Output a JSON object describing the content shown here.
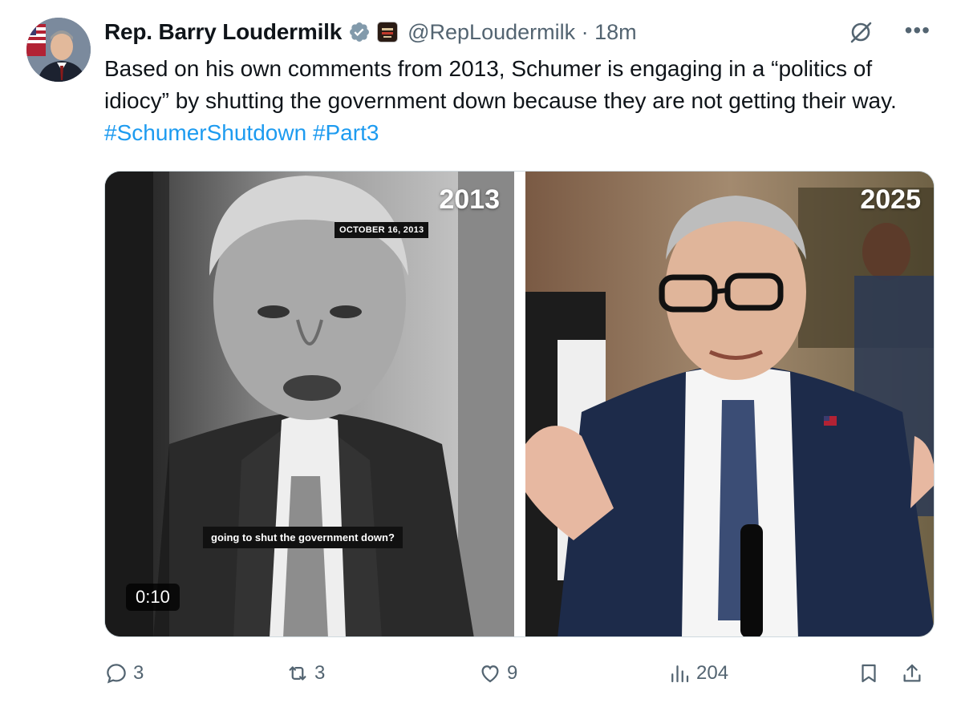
{
  "tweet": {
    "author_name": "Rep. Barry Loudermilk",
    "handle_time": "@RepLoudermilk · 18m",
    "text_main": "Based on his own comments from 2013, Schumer is engaging in a “politics of idiocy” by shutting the government down because they are not getting their way. ",
    "hashtag_1": "#SchumerShutdown",
    "hashtag_2": "#Part3"
  },
  "media": {
    "left_year": "2013",
    "right_year": "2025",
    "dateline": "OCTOBER 16, 2013",
    "caption": "going to shut the government down?",
    "duration": "0:10"
  },
  "actions": {
    "replies": "3",
    "reposts": "3",
    "likes": "9",
    "views": "204"
  },
  "icons": {
    "verified": "verified-badge-icon",
    "affiliate": "affiliate-badge-icon",
    "grok": "grok-icon",
    "more": "more-icon",
    "reply": "reply-icon",
    "repost": "repost-icon",
    "like": "like-icon",
    "views": "views-icon",
    "bookmark": "bookmark-icon",
    "share": "share-icon"
  },
  "colors": {
    "accent": "#1d9bf0",
    "secondary_text": "#536471",
    "primary_text": "#0f1419"
  }
}
